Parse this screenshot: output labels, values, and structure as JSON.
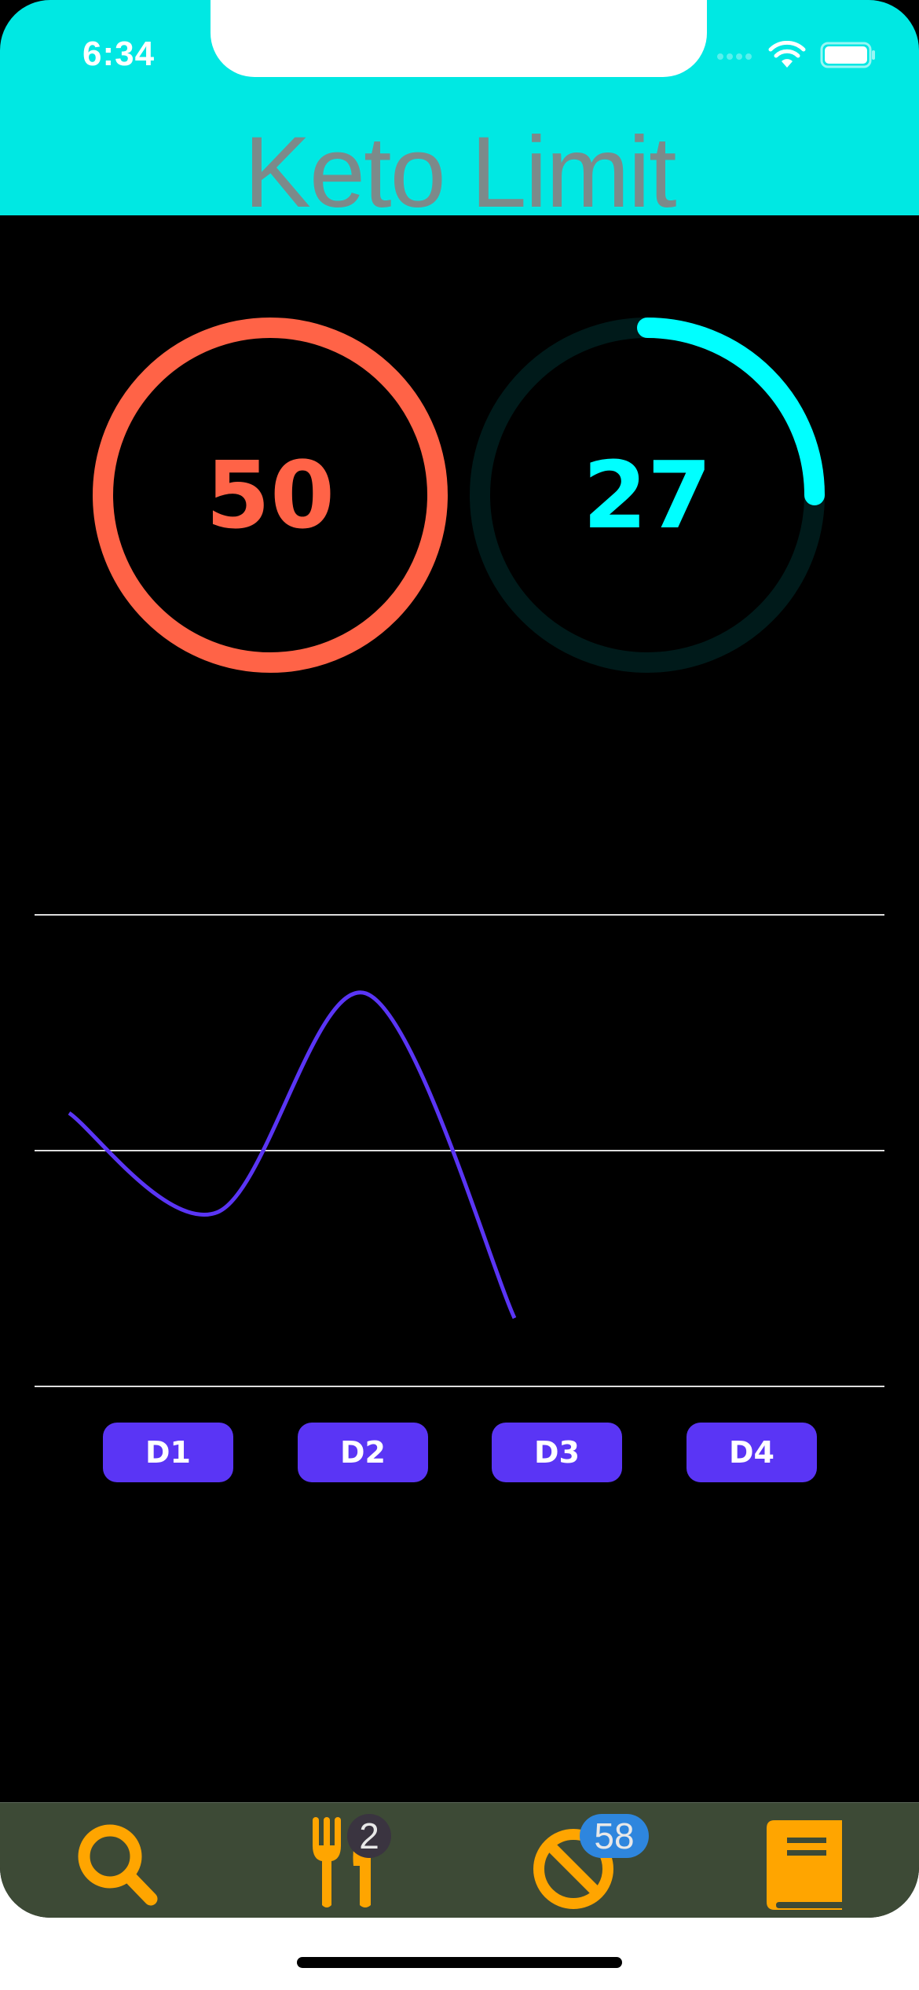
{
  "status_bar": {
    "time": "6:34"
  },
  "header": {
    "title": "Keto Limit"
  },
  "rings": [
    {
      "name": "limit",
      "value": "50",
      "color": "#ff6347",
      "progress": 1.0
    },
    {
      "name": "consumed",
      "value": "27",
      "color": "#00ffff",
      "progress": 0.25
    }
  ],
  "chart_data": {
    "type": "line",
    "x": [
      1,
      2,
      3,
      4
    ],
    "series": [
      {
        "values": [
          60,
          31,
          95,
          0
        ],
        "color": "#5a35f5"
      }
    ],
    "ylim": [
      -20,
      118
    ],
    "gridlines": 3,
    "grid": true
  },
  "days": [
    "D1",
    "D2",
    "D3",
    "D4"
  ],
  "tabbar": {
    "tabs": [
      {
        "icon": "search-icon",
        "badge": ""
      },
      {
        "icon": "fork-knife-icon",
        "badge": "2"
      },
      {
        "icon": "prohibited-icon",
        "badge": "58"
      },
      {
        "icon": "book-icon",
        "badge": ""
      }
    ],
    "accent": "#ffa500"
  }
}
